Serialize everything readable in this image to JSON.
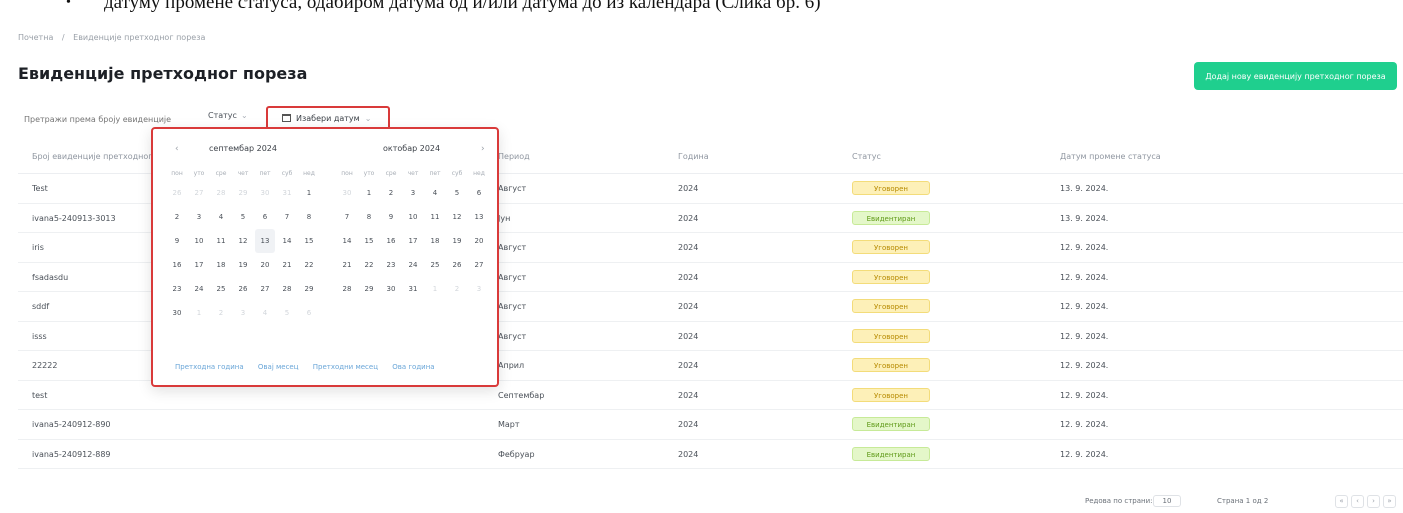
{
  "doc_caption": {
    "bullet": "•",
    "text": "датуму промене статуса, одабиром датума од и/или датума до из календара (Слика бр. 6)"
  },
  "breadcrumb": [
    "Почетна",
    "/",
    "Евиденције претходног пореза"
  ],
  "page_title": "Евиденције претходног пореза",
  "add_button_label": "Додај нову евиденцију претходног пореза",
  "filters": {
    "search_placeholder": "Претражи према броју евиденције",
    "status_label": "Статус",
    "date_label": "Изабери датум",
    "chevron": "⌄"
  },
  "table": {
    "headers": [
      "Број евиденције претходног пореза",
      "Период",
      "Година",
      "Статус",
      "Датум промене статуса"
    ],
    "rows": [
      {
        "number": "Test",
        "period": "Август",
        "year": "2024",
        "status": "Уговорен",
        "status_type": "filed",
        "date": "13. 9. 2024."
      },
      {
        "number": "ivana5-240913-3013",
        "period": "Јун",
        "year": "2024",
        "status": "Евидентиран",
        "status_type": "recorded",
        "date": "13. 9. 2024."
      },
      {
        "number": "iris",
        "period": "Август",
        "year": "2024",
        "status": "Уговорен",
        "status_type": "filed",
        "date": "12. 9. 2024."
      },
      {
        "number": "fsadasdu",
        "period": "Август",
        "year": "2024",
        "status": "Уговорен",
        "status_type": "filed",
        "date": "12. 9. 2024."
      },
      {
        "number": "sddf",
        "period": "Август",
        "year": "2024",
        "status": "Уговорен",
        "status_type": "filed",
        "date": "12. 9. 2024."
      },
      {
        "number": "isss",
        "period": "Август",
        "year": "2024",
        "status": "Уговорен",
        "status_type": "filed",
        "date": "12. 9. 2024."
      },
      {
        "number": "22222",
        "period": "Април",
        "year": "2024",
        "status": "Уговорен",
        "status_type": "filed",
        "date": "12. 9. 2024."
      },
      {
        "number": "test",
        "period": "Септембар",
        "year": "2024",
        "status": "Уговорен",
        "status_type": "filed",
        "date": "12. 9. 2024."
      },
      {
        "number": "ivana5-240912-890",
        "period": "Март",
        "year": "2024",
        "status": "Евидентиран",
        "status_type": "recorded",
        "date": "12. 9. 2024."
      },
      {
        "number": "ivana5-240912-889",
        "period": "Фебруар",
        "year": "2024",
        "status": "Евидентиран",
        "status_type": "recorded",
        "date": "12. 9. 2024."
      }
    ]
  },
  "pagination": {
    "rows_label": "Редова по страни:",
    "rows_value": "10",
    "page_info": "Страна 1 од 2",
    "first": "«",
    "prev": "‹",
    "next": "›",
    "last": "»"
  },
  "datepicker": {
    "prev": "‹",
    "next": "›",
    "left_month": "септембар 2024",
    "right_month": "октобар 2024",
    "weekdays": [
      "пон",
      "уто",
      "сре",
      "чет",
      "пет",
      "суб",
      "нед"
    ],
    "left_days": [
      {
        "d": "26",
        "muted": true
      },
      {
        "d": "27",
        "muted": true
      },
      {
        "d": "28",
        "muted": true
      },
      {
        "d": "29",
        "muted": true
      },
      {
        "d": "30",
        "muted": true
      },
      {
        "d": "31",
        "muted": true
      },
      {
        "d": "1"
      },
      {
        "d": "2"
      },
      {
        "d": "3"
      },
      {
        "d": "4"
      },
      {
        "d": "5"
      },
      {
        "d": "6"
      },
      {
        "d": "7"
      },
      {
        "d": "8"
      },
      {
        "d": "9"
      },
      {
        "d": "10"
      },
      {
        "d": "11"
      },
      {
        "d": "12"
      },
      {
        "d": "13",
        "today": true
      },
      {
        "d": "14"
      },
      {
        "d": "15"
      },
      {
        "d": "16"
      },
      {
        "d": "17"
      },
      {
        "d": "18"
      },
      {
        "d": "19"
      },
      {
        "d": "20"
      },
      {
        "d": "21"
      },
      {
        "d": "22"
      },
      {
        "d": "23"
      },
      {
        "d": "24"
      },
      {
        "d": "25"
      },
      {
        "d": "26"
      },
      {
        "d": "27"
      },
      {
        "d": "28"
      },
      {
        "d": "29"
      },
      {
        "d": "30"
      },
      {
        "d": "1",
        "muted": true
      },
      {
        "d": "2",
        "muted": true
      },
      {
        "d": "3",
        "muted": true
      },
      {
        "d": "4",
        "muted": true
      },
      {
        "d": "5",
        "muted": true
      },
      {
        "d": "6",
        "muted": true
      }
    ],
    "right_days": [
      {
        "d": "30",
        "muted": true
      },
      {
        "d": "1"
      },
      {
        "d": "2"
      },
      {
        "d": "3"
      },
      {
        "d": "4"
      },
      {
        "d": "5"
      },
      {
        "d": "6"
      },
      {
        "d": "7"
      },
      {
        "d": "8"
      },
      {
        "d": "9"
      },
      {
        "d": "10"
      },
      {
        "d": "11"
      },
      {
        "d": "12"
      },
      {
        "d": "13"
      },
      {
        "d": "14"
      },
      {
        "d": "15"
      },
      {
        "d": "16"
      },
      {
        "d": "17"
      },
      {
        "d": "18"
      },
      {
        "d": "19"
      },
      {
        "d": "20"
      },
      {
        "d": "21"
      },
      {
        "d": "22"
      },
      {
        "d": "23"
      },
      {
        "d": "24"
      },
      {
        "d": "25"
      },
      {
        "d": "26"
      },
      {
        "d": "27"
      },
      {
        "d": "28"
      },
      {
        "d": "29"
      },
      {
        "d": "30"
      },
      {
        "d": "31"
      },
      {
        "d": "1",
        "muted": true
      },
      {
        "d": "2",
        "muted": true
      },
      {
        "d": "3",
        "muted": true
      }
    ],
    "shortcuts": [
      "Претходна година",
      "Овај месец",
      "Претходни месец",
      "Ова година"
    ]
  },
  "colors": {
    "accent_green": "#1fcf8e",
    "highlight_red": "#d93a3a",
    "link_blue": "#6aa6d8"
  }
}
